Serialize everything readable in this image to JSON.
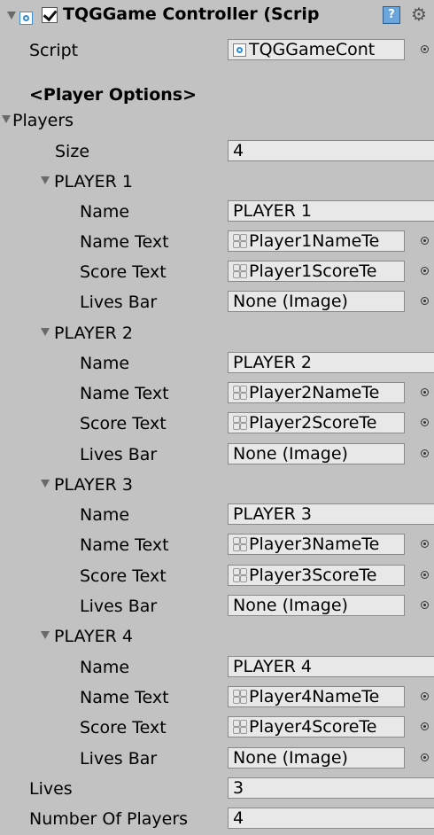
{
  "component": {
    "title": "TQGGame Controller (Scrip",
    "enabled": true,
    "help_glyph": "?",
    "gear_glyph": "⚙"
  },
  "script": {
    "label": "Script",
    "value": "TQGGameCont"
  },
  "section_header": "<Player Options>",
  "players": {
    "label": "Players",
    "size_label": "Size",
    "size_value": "4",
    "items": [
      {
        "header": "PLAYER 1",
        "name_label": "Name",
        "name_value": "PLAYER 1",
        "name_text_label": "Name Text",
        "name_text_value": "Player1NameTe",
        "score_text_label": "Score Text",
        "score_text_value": "Player1ScoreTe",
        "lives_bar_label": "Lives Bar",
        "lives_bar_value": "None (Image)"
      },
      {
        "header": "PLAYER 2",
        "name_label": "Name",
        "name_value": "PLAYER 2",
        "name_text_label": "Name Text",
        "name_text_value": "Player2NameTe",
        "score_text_label": "Score Text",
        "score_text_value": "Player2ScoreTe",
        "lives_bar_label": "Lives Bar",
        "lives_bar_value": "None (Image)"
      },
      {
        "header": "PLAYER 3",
        "name_label": "Name",
        "name_value": "PLAYER 3",
        "name_text_label": "Name Text",
        "name_text_value": "Player3NameTe",
        "score_text_label": "Score Text",
        "score_text_value": "Player3ScoreTe",
        "lives_bar_label": "Lives Bar",
        "lives_bar_value": "None (Image)"
      },
      {
        "header": "PLAYER 4",
        "name_label": "Name",
        "name_value": "PLAYER 4",
        "name_text_label": "Name Text",
        "name_text_value": "Player4NameTe",
        "score_text_label": "Score Text",
        "score_text_value": "Player4ScoreTe",
        "lives_bar_label": "Lives Bar",
        "lives_bar_value": "None (Image)"
      }
    ]
  },
  "lives": {
    "label": "Lives",
    "value": "3"
  },
  "number_of_players": {
    "label": "Number Of Players",
    "value": "4"
  },
  "colors": {
    "background": "#c2c2c2",
    "field": "#e8e8e8",
    "script_icon": "#2f8ad8"
  }
}
